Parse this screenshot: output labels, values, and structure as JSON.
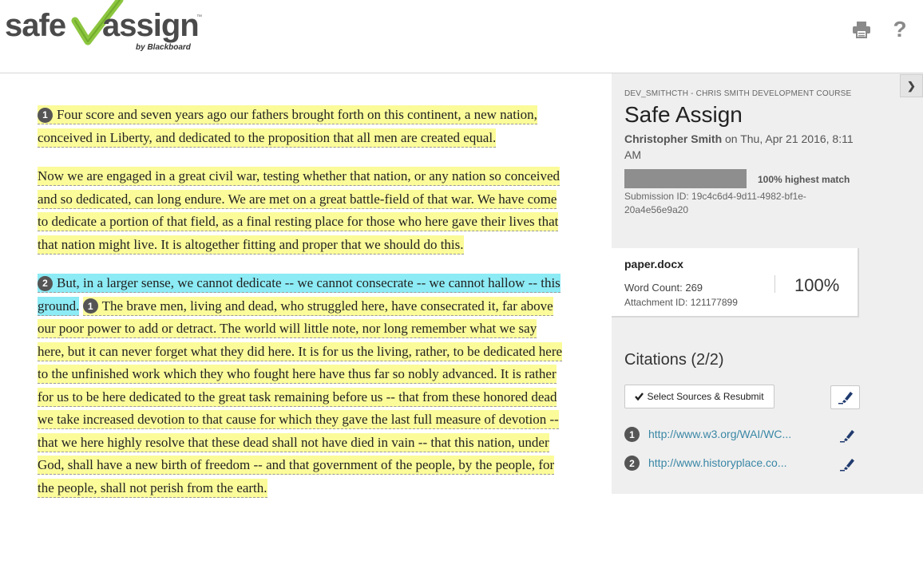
{
  "header": {
    "logo_left": "safe",
    "logo_right": "assign",
    "logo_tm": "™",
    "logo_by": "by Blackboard",
    "print_icon": "printer-icon",
    "help_icon": "question-mark-icon",
    "help_glyph": "?"
  },
  "document": {
    "p1": {
      "marker": "1",
      "text": "Four score and seven years ago our fathers brought forth on this continent, a new nation, conceived in Liberty, and dedicated to the proposition that all men are created equal."
    },
    "p2": {
      "text": "Now we are engaged in a great civil war, testing whether that nation, or any nation so conceived and so dedicated, can long endure.  We are met on a great battle-field of that war.  We have come to dedicate a portion of that field, as a final resting place for those who here gave their lives that that nation might live.  It is altogether fitting and proper that we should do this."
    },
    "p3": {
      "marker_a": "2",
      "text_a": "But, in a larger sense, we cannot dedicate -- we cannot consecrate -- we cannot hallow -- this ground.",
      "marker_b": "1",
      "text_b": "The brave men, living and dead, who struggled here, have consecrated it, far above our poor power to add or detract.  The world will little note, nor long remember what we say here, but it can never forget what they did here.  It is for us the living, rather, to be dedicated here to the unfinished work which they who fought here have thus far so nobly advanced.  It is rather for us to be here dedicated to the great task remaining before us -- that from these honored dead we take increased devotion to that cause for which they gave the last full measure of devotion -- that we here highly resolve that these dead shall not have died in vain -- that this nation, under God, shall have a new birth of freedom -- and that government of the people, by the people, for the people, shall not perish from the earth."
    }
  },
  "panel": {
    "collapse_icon": "chevron-right-icon",
    "course": "DEV_SMITHCTH - CHRIS SMITH DEVELOPMENT COURSE",
    "title": "Safe Assign",
    "author": "Christopher Smith",
    "submitted_on": " on Thu, Apr 21 2016, 8:11 AM",
    "highest_match": 1.0,
    "highest_match_label": "100% highest match",
    "submission_id": "Submission ID: 19c4c6d4-9d11-4982-bf1e-20a4e56e9a20",
    "file": {
      "name": "paper.docx",
      "word_count": "Word Count: 269",
      "attachment_id": "Attachment ID: 121177899",
      "percent": "100%"
    },
    "citations_title": "Citations (2/2)",
    "resubmit_label": "Select Sources & Resubmit",
    "citations": [
      {
        "number": "1",
        "url": "http://www.w3.org/WAI/WC...",
        "icon": "highlighter-icon"
      },
      {
        "number": "2",
        "url": "http://www.historyplace.co...",
        "icon": "highlighter-icon"
      }
    ]
  },
  "colors": {
    "highlight_source_1": "#fbfb9a",
    "highlight_source_2": "#8cebf5",
    "logo_check": "#8cc63f",
    "link": "#3a87a6"
  }
}
